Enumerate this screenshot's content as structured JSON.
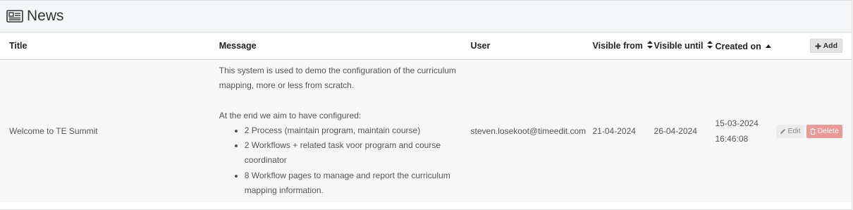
{
  "header": {
    "title": "News",
    "icon": "newspaper-icon"
  },
  "table": {
    "columns": {
      "title": "Title",
      "message": "Message",
      "user": "User",
      "visible_from": "Visible from",
      "visible_until": "Visible until",
      "created_on": "Created on"
    },
    "add_label": "Add",
    "rows": [
      {
        "title": "Welcome to TE Summit",
        "message_line1": "This system is used to demo the configuration of the curriculum",
        "message_line2": "mapping, more or less from scratch.",
        "message_line3": "At the end we aim to have configured:",
        "bullets": [
          "2 Process (maintain program, maintain course)",
          "2 Workflows + related task voor program and course coordinator",
          "8 Workflow pages to manage and report the curriculum mapping information."
        ],
        "user": "steven.losekoot@timeedit.com",
        "visible_from": "21-04-2024",
        "visible_until": "26-04-2024",
        "created_date": "15-03-2024",
        "created_time": "16:46:08",
        "edit_label": "Edit",
        "delete_label": "Delete"
      }
    ]
  },
  "colors": {
    "delete": "#ec9a98",
    "header_bg": "#f5f6f7",
    "row_bg": "#f7f7f7"
  }
}
